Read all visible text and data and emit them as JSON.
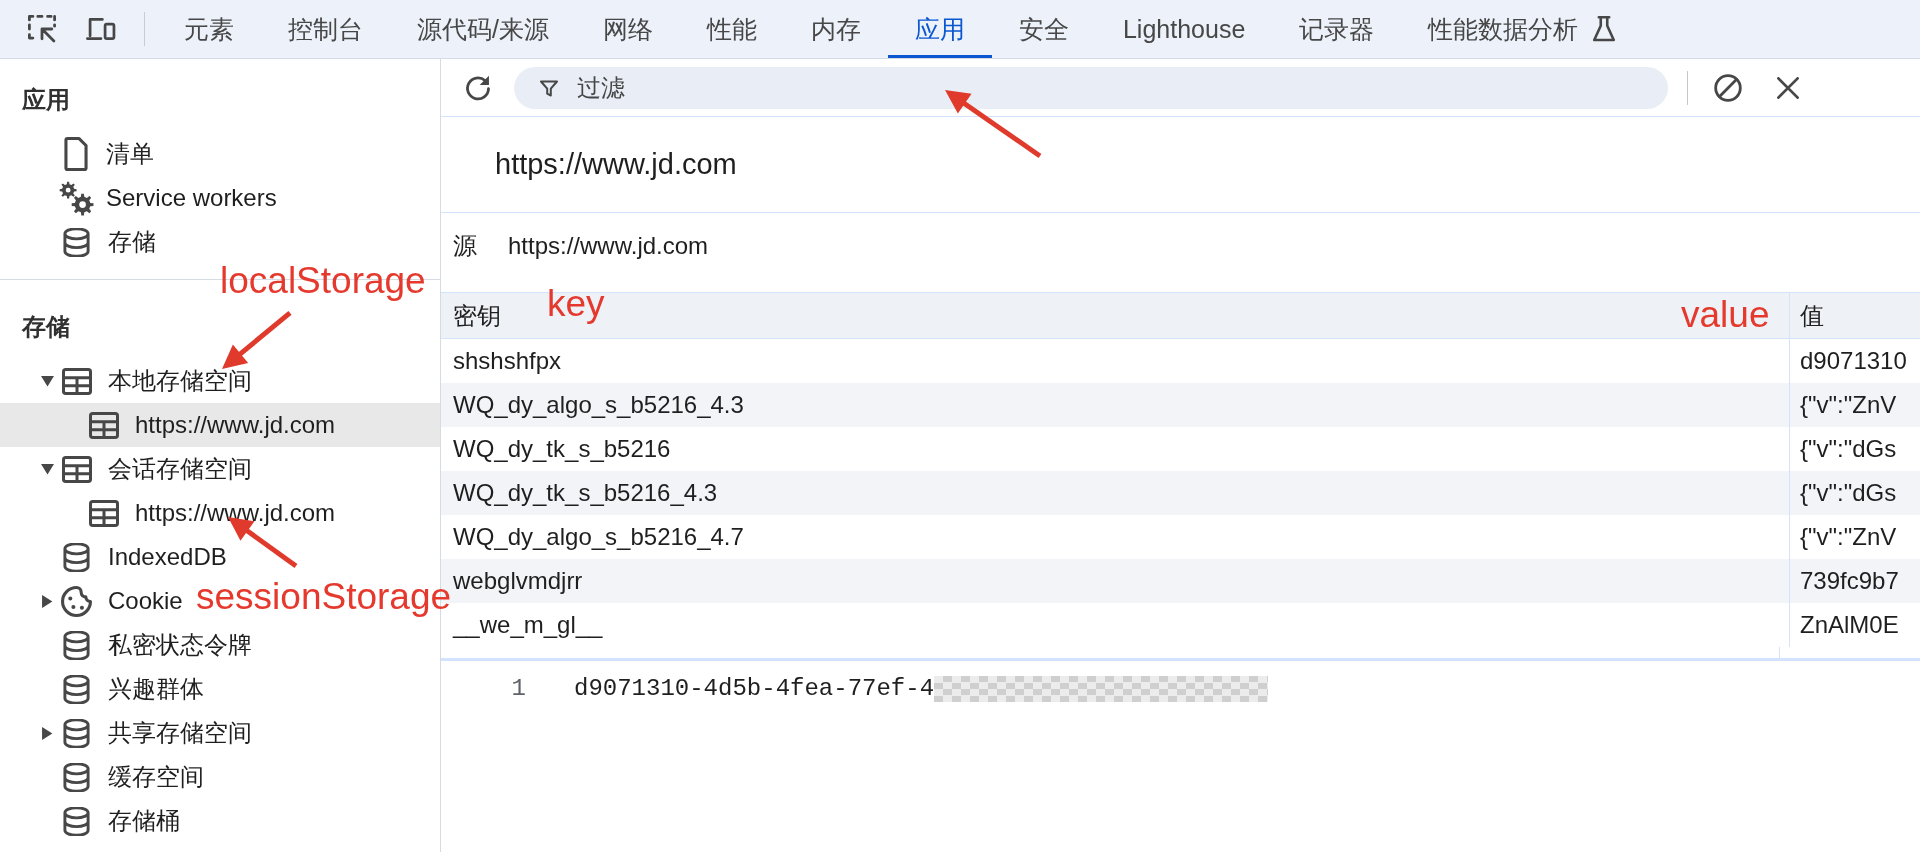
{
  "tabbar": {
    "tabs": [
      {
        "label": "元素",
        "selected": false,
        "experimental": false
      },
      {
        "label": "控制台",
        "selected": false,
        "experimental": false
      },
      {
        "label": "源代码/来源",
        "selected": false,
        "experimental": false
      },
      {
        "label": "网络",
        "selected": false,
        "experimental": false
      },
      {
        "label": "性能",
        "selected": false,
        "experimental": false
      },
      {
        "label": "内存",
        "selected": false,
        "experimental": false
      },
      {
        "label": "应用",
        "selected": true,
        "experimental": false
      },
      {
        "label": "安全",
        "selected": false,
        "experimental": false
      },
      {
        "label": "Lighthouse",
        "selected": false,
        "experimental": false
      },
      {
        "label": "记录器",
        "selected": false,
        "experimental": false
      },
      {
        "label": "性能数据分析",
        "selected": false,
        "experimental": true
      }
    ]
  },
  "sidebar": {
    "sections": [
      {
        "title": "应用",
        "items": [
          {
            "kind": "file",
            "label": "清单",
            "selected": false
          },
          {
            "kind": "worker",
            "label": "Service workers",
            "selected": false
          },
          {
            "kind": "database",
            "label": "存储",
            "selected": false
          }
        ]
      },
      {
        "title": "存储",
        "items": [
          {
            "kind": "table",
            "label": "本地存储空间",
            "selected": false,
            "expanded": true,
            "children": [
              {
                "kind": "table",
                "label": "https://www.jd.com",
                "selected": true
              }
            ]
          },
          {
            "kind": "table",
            "label": "会话存储空间",
            "selected": false,
            "expanded": true,
            "children": [
              {
                "kind": "table",
                "label": "https://www.jd.com",
                "selected": false
              }
            ]
          },
          {
            "kind": "database",
            "label": "IndexedDB",
            "selected": false
          },
          {
            "kind": "cookie",
            "label": "Cookie",
            "selected": false,
            "expanded": false
          },
          {
            "kind": "database",
            "label": "私密状态令牌",
            "selected": false
          },
          {
            "kind": "database",
            "label": "兴趣群体",
            "selected": false
          },
          {
            "kind": "database",
            "label": "共享存储空间",
            "selected": false,
            "expanded": false
          },
          {
            "kind": "database",
            "label": "缓存空间",
            "selected": false
          },
          {
            "kind": "database",
            "label": "存储桶",
            "selected": false
          }
        ]
      }
    ]
  },
  "toolbar": {
    "filter": {
      "placeholder": "过滤"
    }
  },
  "origin_title": "https://www.jd.com",
  "origin": {
    "label": "源",
    "value": "https://www.jd.com"
  },
  "table": {
    "columns": [
      "密钥",
      "值"
    ],
    "rows": [
      {
        "key": "shshshfpx",
        "value": "d9071310"
      },
      {
        "key": "WQ_dy_algo_s_b5216_4.3",
        "value": "{\"v\":\"ZnV"
      },
      {
        "key": "WQ_dy_tk_s_b5216",
        "value": "{\"v\":\"dGs"
      },
      {
        "key": "WQ_dy_tk_s_b5216_4.3",
        "value": "{\"v\":\"dGs"
      },
      {
        "key": "WQ_dy_algo_s_b5216_4.7",
        "value": "{\"v\":\"ZnV"
      },
      {
        "key": "webglvmdjrr",
        "value": "739fc9b7"
      },
      {
        "key": "__we_m_gl__",
        "value": "ZnAlM0E"
      }
    ]
  },
  "preview": {
    "line_number": "1",
    "text": "d9071310-4d5b-4fea-77ef-4",
    "redacted": true
  },
  "annotations": [
    {
      "kind": "callout",
      "text": "localStorage"
    },
    {
      "kind": "label",
      "text": "key"
    },
    {
      "kind": "label",
      "text": "value"
    },
    {
      "kind": "callout",
      "text": "sessionStorage"
    },
    {
      "kind": "arrow"
    }
  ]
}
